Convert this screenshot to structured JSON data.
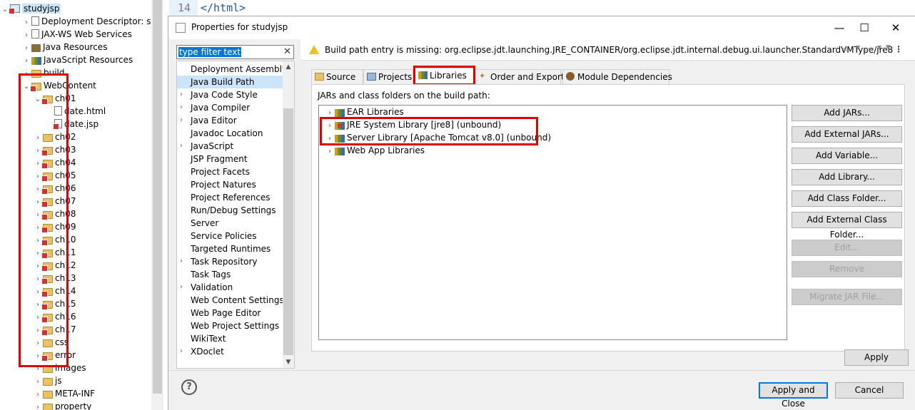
{
  "editor": {
    "line_number": "14",
    "code": "</html>"
  },
  "project_tree": {
    "project": "studyjsp",
    "items": [
      {
        "label": "Deployment Descriptor: stu",
        "icon": "descriptor"
      },
      {
        "label": "JAX-WS Web Services",
        "icon": "webservice"
      },
      {
        "label": "Java Resources",
        "icon": "package"
      },
      {
        "label": "JavaScript Resources",
        "icon": "library"
      },
      {
        "label": "build",
        "icon": "folder"
      },
      {
        "label": "WebContent",
        "icon": "folder-error"
      },
      {
        "label": "ch01",
        "icon": "folder-error"
      },
      {
        "label": "date.html",
        "icon": "file"
      },
      {
        "label": "date.jsp",
        "icon": "file-error"
      },
      {
        "label": "ch02",
        "icon": "folder"
      },
      {
        "label": "ch03",
        "icon": "folder-error"
      },
      {
        "label": "ch04",
        "icon": "folder-error"
      },
      {
        "label": "ch05",
        "icon": "folder-error"
      },
      {
        "label": "ch06",
        "icon": "folder-error"
      },
      {
        "label": "ch07",
        "icon": "folder-error"
      },
      {
        "label": "ch08",
        "icon": "folder-error"
      },
      {
        "label": "ch09",
        "icon": "folder-error"
      },
      {
        "label": "ch10",
        "icon": "folder-error"
      },
      {
        "label": "ch11",
        "icon": "folder-error"
      },
      {
        "label": "ch12",
        "icon": "folder-error"
      },
      {
        "label": "ch13",
        "icon": "folder-error"
      },
      {
        "label": "ch14",
        "icon": "folder-error"
      },
      {
        "label": "ch15",
        "icon": "folder-error"
      },
      {
        "label": "ch16",
        "icon": "folder-error"
      },
      {
        "label": "ch17",
        "icon": "folder-error"
      },
      {
        "label": "css",
        "icon": "folder"
      },
      {
        "label": "error",
        "icon": "folder-error"
      },
      {
        "label": "images",
        "icon": "folder"
      },
      {
        "label": "js",
        "icon": "folder"
      },
      {
        "label": "META-INF",
        "icon": "folder"
      },
      {
        "label": "property",
        "icon": "folder"
      }
    ]
  },
  "dialog": {
    "title": "Properties for studyjsp",
    "filter_placeholder": "type filter text",
    "filter_selected_text": "type filter text",
    "nav_items": [
      "Deployment Assembly",
      "Java Build Path",
      "Java Code Style",
      "Java Compiler",
      "Java Editor",
      "Javadoc Location",
      "JavaScript",
      "JSP Fragment",
      "Project Facets",
      "Project Natures",
      "Project References",
      "Run/Debug Settings",
      "Server",
      "Service Policies",
      "Targeted Runtimes",
      "Task Repository",
      "Task Tags",
      "Validation",
      "Web Content Settings",
      "Web Page Editor",
      "Web Project Settings",
      "WikiText",
      "XDoclet"
    ],
    "selected_nav": "Java Build Path",
    "message": "Build path entry is missing: org.eclipse.jdt.launching.JRE_CONTAINER/org.eclipse.jdt.internal.debug.ui.launcher.StandardVMType/jre8",
    "tabs": [
      "Source",
      "Projects",
      "Libraries",
      "Order and Export",
      "Module Dependencies"
    ],
    "active_tab": "Libraries",
    "panel_label": "JARs and class folders on the build path:",
    "libraries": [
      "EAR Libraries",
      "JRE System Library [jre8] (unbound)",
      "Server Library [Apache Tomcat v8.0] (unbound)",
      "Web App Libraries"
    ],
    "buttons": {
      "add_jars": "Add JARs...",
      "add_external_jars": "Add External JARs...",
      "add_variable": "Add Variable...",
      "add_library": "Add Library...",
      "add_class_folder": "Add Class Folder...",
      "add_external_class_folder": "Add External Class Folder...",
      "edit": "Edit...",
      "remove": "Remove",
      "migrate_jar": "Migrate JAR File...",
      "apply": "Apply",
      "apply_and_close": "Apply and Close",
      "cancel": "Cancel"
    }
  },
  "colors": {
    "highlight_box": "#e00000",
    "selection": "#cce4f7",
    "accent": "#0078d7"
  }
}
